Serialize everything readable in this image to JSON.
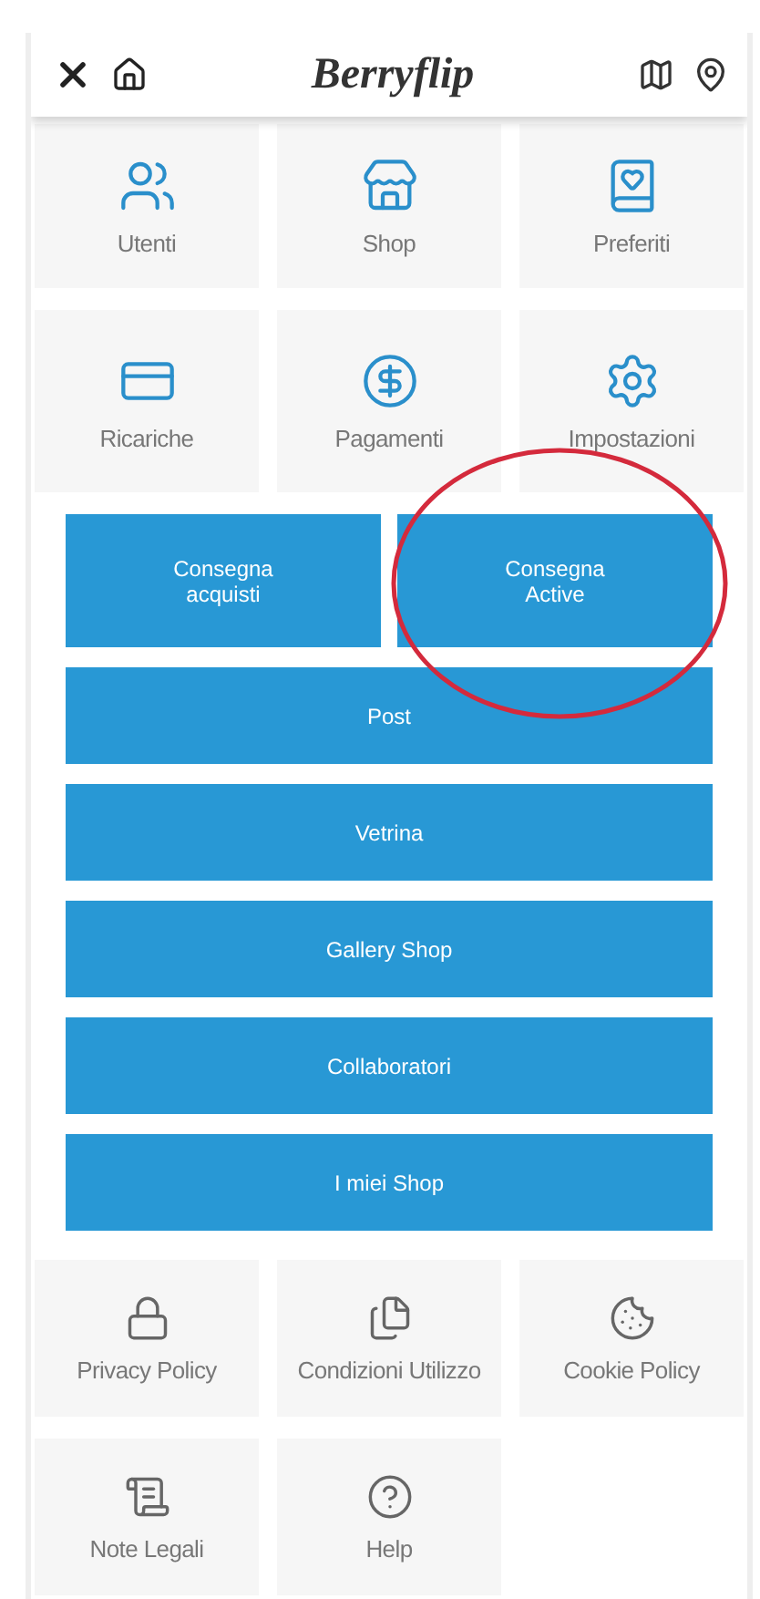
{
  "header": {
    "logo": "Berryflip"
  },
  "top_tiles": [
    {
      "label": "Utenti"
    },
    {
      "label": "Shop"
    },
    {
      "label": "Preferiti"
    },
    {
      "label": "Ricariche"
    },
    {
      "label": "Pagamenti"
    },
    {
      "label": "Impostazioni"
    }
  ],
  "action_buttons": [
    {
      "label": "Consegna acquisti",
      "highlighted": false
    },
    {
      "label": "Consegna Active",
      "highlighted": true
    },
    {
      "label": "Post",
      "highlighted": false
    },
    {
      "label": "Vetrina",
      "highlighted": false
    },
    {
      "label": "Gallery Shop",
      "highlighted": false
    },
    {
      "label": "Collaboratori",
      "highlighted": false
    },
    {
      "label": "I miei Shop",
      "highlighted": false
    }
  ],
  "bottom_tiles": [
    {
      "label": "Privacy Policy"
    },
    {
      "label": "Condizioni Utilizzo"
    },
    {
      "label": "Cookie Policy"
    },
    {
      "label": "Note Legali"
    },
    {
      "label": "Help"
    }
  ]
}
